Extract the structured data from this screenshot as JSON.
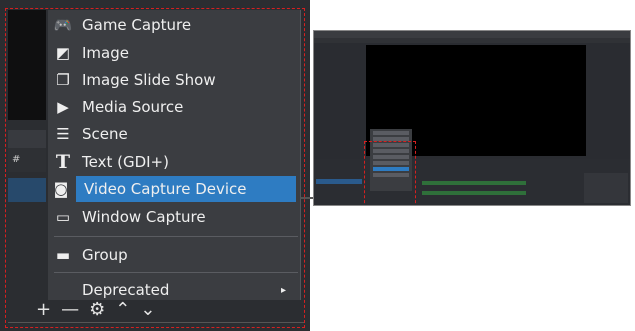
{
  "menu": {
    "items": [
      {
        "label": "Game Capture",
        "icon": "gamepad-icon",
        "glyph": "🎮"
      },
      {
        "label": "Image",
        "icon": "image-icon",
        "glyph": "◩"
      },
      {
        "label": "Image Slide Show",
        "icon": "slideshow-icon",
        "glyph": "❐"
      },
      {
        "label": "Media Source",
        "icon": "play-icon",
        "glyph": "▶"
      },
      {
        "label": "Scene",
        "icon": "list-icon",
        "glyph": "☰"
      },
      {
        "label": "Text (GDI+)",
        "icon": "text-icon",
        "glyph": "T"
      },
      {
        "label": "Video Capture Device",
        "icon": "camera-icon",
        "glyph": "◙"
      },
      {
        "label": "Window Capture",
        "icon": "window-icon",
        "glyph": "▭"
      },
      {
        "label": "Group",
        "icon": "folder-icon",
        "glyph": "▬"
      },
      {
        "label": "Deprecated",
        "icon": "",
        "glyph": ""
      }
    ],
    "selected": "Video Capture Device",
    "submenu_arrow": "▸"
  },
  "toolbar": {
    "add": "+",
    "remove": "—",
    "settings": "⚙",
    "up": "⌃",
    "down": "⌄"
  },
  "panel": {
    "hash": "#"
  },
  "colors": {
    "highlight": "#2e7cc2",
    "menu_bg": "#3b3d41",
    "dash": "#d62020"
  }
}
